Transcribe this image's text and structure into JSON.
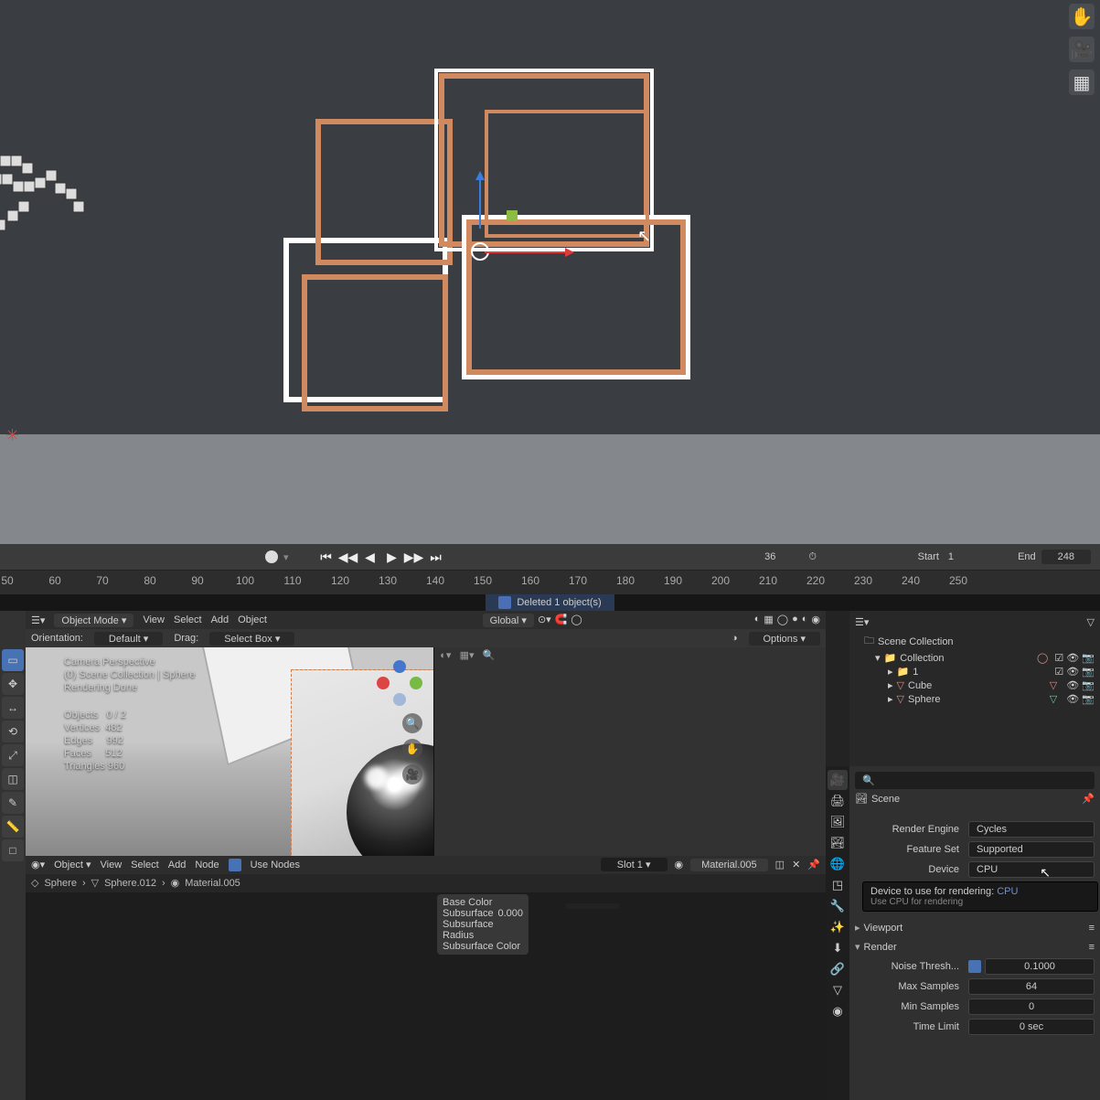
{
  "viewport_tools": {
    "pan": "✋",
    "camera": "🎥",
    "grid": "▦"
  },
  "timeline": {
    "play_controls": [
      "⏮",
      "◀◀",
      "◀",
      "▶",
      "▶▶",
      "⏭"
    ],
    "current_frame": "36",
    "start_label": "Start",
    "start_value": "1",
    "end_label": "End",
    "end_value": "248",
    "ticks": [
      "50",
      "60",
      "70",
      "80",
      "90",
      "100",
      "110",
      "120",
      "130",
      "140",
      "150",
      "160",
      "170",
      "180",
      "190",
      "200",
      "210",
      "220",
      "230",
      "240",
      "250"
    ]
  },
  "status": {
    "message": "Deleted 1 object(s)"
  },
  "menubar": {
    "mode": "Object Mode",
    "items": [
      "View",
      "Select",
      "Add",
      "Object"
    ],
    "orient_label": "Global"
  },
  "optbar": {
    "orientation_label": "Orientation:",
    "orientation": "Default",
    "drag_label": "Drag:",
    "drag_value": "Select Box",
    "options_label": "Options"
  },
  "vp_overlay": {
    "camera": "Camera Perspective",
    "scene": "(0) Scene Collection | Sphere",
    "render_status": "Rendering Done",
    "objects_label": "Objects",
    "objects": "0 / 2",
    "verts_label": "Vertices",
    "verts": "482",
    "edges_label": "Edges",
    "edges": "992",
    "faces_label": "Faces",
    "faces": "512",
    "tris_label": "Triangles",
    "tris": "960"
  },
  "nodebar": {
    "mode": "Object",
    "menu": [
      "View",
      "Select",
      "Add",
      "Node"
    ],
    "use_nodes": "Use Nodes",
    "slot": "Slot 1",
    "material": "Material.005"
  },
  "breadcrumb": {
    "obj": "Sphere",
    "mesh": "Sphere.012",
    "mat": "Material.005"
  },
  "nodes": {
    "base": "Base Color",
    "subsurf": "Subsurface",
    "subsurfr": "Subsurface Radius",
    "subsurfc": "Subsurface Color",
    "val": "0.000"
  },
  "outliner": {
    "title": "Scene Collection",
    "collection": "Collection",
    "one": "1",
    "cube": "Cube",
    "sphere": "Sphere"
  },
  "props": {
    "scene_label": "Scene",
    "render_engine_label": "Render Engine",
    "render_engine": "Cycles",
    "feature_set_label": "Feature Set",
    "feature_set": "Supported",
    "device_label": "Device",
    "device": "CPU",
    "tooltip_main": "Device to use for rendering:",
    "tooltip_val": "CPU",
    "tooltip_sub": "Use CPU for rendering",
    "viewport_section": "Viewport",
    "render_section": "Render",
    "noise_thresh_label": "Noise Thresh...",
    "noise_thresh": "0.1000",
    "max_samples_label": "Max Samples",
    "max_samples": "64",
    "min_samples_label": "Min Samples",
    "min_samples": "0",
    "time_limit_label": "Time Limit",
    "time_limit": "0 sec"
  }
}
